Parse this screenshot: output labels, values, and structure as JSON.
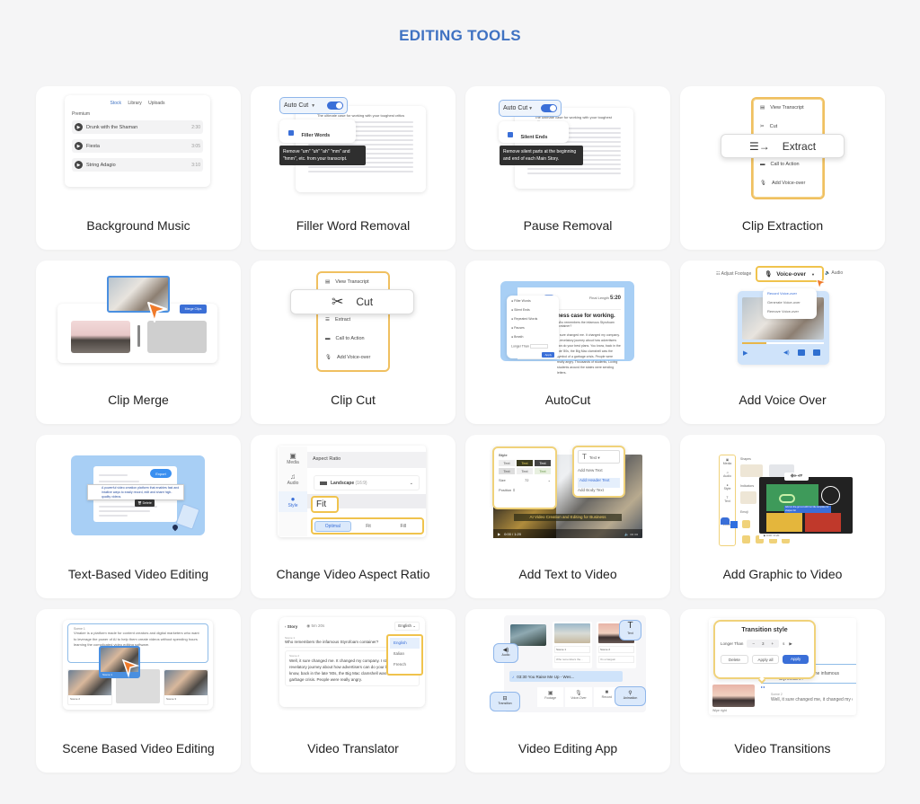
{
  "page": {
    "title": "EDITING TOOLS"
  },
  "colors": {
    "accent": "#3f72c2",
    "highlight_gold": "#f0c34d",
    "cursor_orange": "#f07a2a",
    "toggle_blue": "#3a6fd8"
  },
  "cards": [
    {
      "label": "Background Music",
      "preview": {
        "tabs": [
          "Stock",
          "Library",
          "Uploads"
        ],
        "active_tab": "Stock",
        "section": "Premium",
        "tracks": [
          {
            "name": "Drunk with the Shaman",
            "duration": "2:30"
          },
          {
            "name": "Fiesta",
            "duration": "3:05"
          },
          {
            "name": "String Adagio",
            "duration": "3:10"
          }
        ]
      }
    },
    {
      "label": "Filler Word Removal",
      "preview": {
        "dropdown": "Auto Cut",
        "option": "Filler Words",
        "tooltip": "Remove \"um\" \"uh\" \"ah\" \"mm\" and \"hmm\", etc. from your transcript.",
        "doc_heading": "The ultimate case for working with your toughest critics"
      }
    },
    {
      "label": "Pause Removal",
      "preview": {
        "dropdown": "Auto Cut",
        "option": "Silent Ends",
        "tooltip": "Remove silent parts at the beginning and end of each Main Story.",
        "doc_heading": "The ultimate case for working with your toughest critics"
      }
    },
    {
      "label": "Clip Extraction",
      "preview": {
        "menu": [
          "View Transcript",
          "Cut",
          "Extract",
          "Call to Action",
          "Add Voice-over"
        ],
        "highlighted": "Extract"
      }
    },
    {
      "label": "Clip Merge",
      "preview": {
        "button": "Merge Clips"
      }
    },
    {
      "label": "Clip Cut",
      "preview": {
        "menu": [
          "View Transcript",
          "Cut",
          "Extract",
          "Call to Action",
          "Add Voice-over"
        ],
        "highlighted": "Cut"
      }
    },
    {
      "label": "AutoCut",
      "preview": {
        "dropdown": "Auto Cut",
        "length_label": "Final Length",
        "length_value": "5:20",
        "heading": "ness case for working.",
        "subline": "Who remembers the infamous Styrofoam container?",
        "options": [
          "Filler Words",
          "Silent Ends",
          "Repeated Words",
          "Pauses",
          "Breath"
        ],
        "longer_than": "Longer Than",
        "apply": "Apply",
        "body": "It sure changed me. It changed my company. A revelatory journey about how advertisers can do your best plans. You know, back in the late '80s, the Big Mac clamshell was the symbol of a garbage crisis. People were really angry. Thousands of students, Loving students around the states were sending letters."
      }
    },
    {
      "label": "Add Voice Over",
      "preview": {
        "toolbar": [
          "Adjust Footage",
          "Voice-over",
          "Audio"
        ],
        "menu": [
          "Record Voice-over",
          "Generate Voice-over",
          "Remove Voice-over"
        ],
        "progress": 0.3
      }
    },
    {
      "label": "Text-Based Video Editing",
      "preview": {
        "button": "Export",
        "popup_action": "Delete",
        "selected_text": "A powerful video creation platform that enables fast and intuitive ways to easily record, edit and share high-quality videos."
      }
    },
    {
      "label": "Change Video Aspect Ratio",
      "preview": {
        "sidebar": [
          "Media",
          "Audio",
          "Style"
        ],
        "active_sidebar": "Style",
        "section": "Aspect Ratio",
        "select": "Landscape",
        "select_hint": "(16:9)",
        "callout": "Fit",
        "segments": [
          "Optimal",
          "Fit",
          "Fill"
        ],
        "active_segment": "Optimal"
      }
    },
    {
      "label": "Add Text to Video",
      "preview": {
        "style_title": "Style",
        "style_chips": [
          "Text",
          "Text",
          "Text",
          "Text",
          "Text",
          "Text"
        ],
        "size_label": "Size",
        "size_value": "72",
        "position_label": "Position",
        "text_dropdown": "Text",
        "text_menu": [
          "Add New Text",
          "Add Header Text",
          "Add Body Text"
        ],
        "active_item": "Add Header Text",
        "caption": "AI Video Creation and Editing for Business",
        "time": "0:00 / 1:20"
      }
    },
    {
      "label": "Add Graphic to Video",
      "preview": {
        "sidebar": [
          "Media",
          "Audio",
          "Style",
          "Text",
          "Effect"
        ],
        "sections": [
          "Shapes",
          "Indicators",
          "Emoji"
        ],
        "caption": "Add on-the-go text with fun title template for shapes list",
        "time": "0:00 / 0:20"
      }
    },
    {
      "label": "Scene Based Video Editing",
      "preview": {
        "scene_title": "Scene 1",
        "scene_text": "Vmaker is a platform made for content creators and digital marketers who want to leverage the power of AI to help them create videos without spending hours learning the complicated video editing software.",
        "dragging": "Scene 1",
        "scenes": [
          "Scene 2",
          "Scene 3"
        ]
      }
    },
    {
      "label": "Video Translator",
      "preview": {
        "back": "Story",
        "duration": "5m 20s",
        "language": "English",
        "languages": [
          "English",
          "Italian",
          "French"
        ],
        "scene1_title": "Scene 1",
        "scene1_text": "Who remembers the infamous Styrofoam container?",
        "scene2_title": "Scene 2",
        "scene2_text": "Well, it sure changed me. It changed my company. I started a revelatory journey about how advertisers can do your best allies. You know, back in the late '80s, the Big Mac clamshell was the symbol of a garbage crisis. People were really angry."
      }
    },
    {
      "label": "Video Editing App",
      "preview": {
        "badges": [
          "Audio",
          "Text",
          "Transition",
          "Animation"
        ],
        "scenes": [
          {
            "title": "Scene 1",
            "text": "Who remembers the..."
          },
          {
            "title": "Scene 2",
            "text": "It's a bargain"
          }
        ],
        "track": "03:30  You Raise Me Up - Wes...",
        "tools": [
          "Footage",
          "Voice-Over",
          "Record"
        ]
      }
    },
    {
      "label": "Video Transitions",
      "preview": {
        "title": "Transition style",
        "longer_than": "Longer Than",
        "value": "3",
        "unit": "s",
        "buttons": [
          "Delete",
          "Apply all",
          "Apply"
        ],
        "bg_text": "Who remembers the infamous Styrofoam...",
        "scene_title": "Scene 2",
        "scene_text": "Well, it sure changed me, it changed my company. I started a revelatory journey...",
        "thumb_label": "Wipe right"
      }
    }
  ]
}
